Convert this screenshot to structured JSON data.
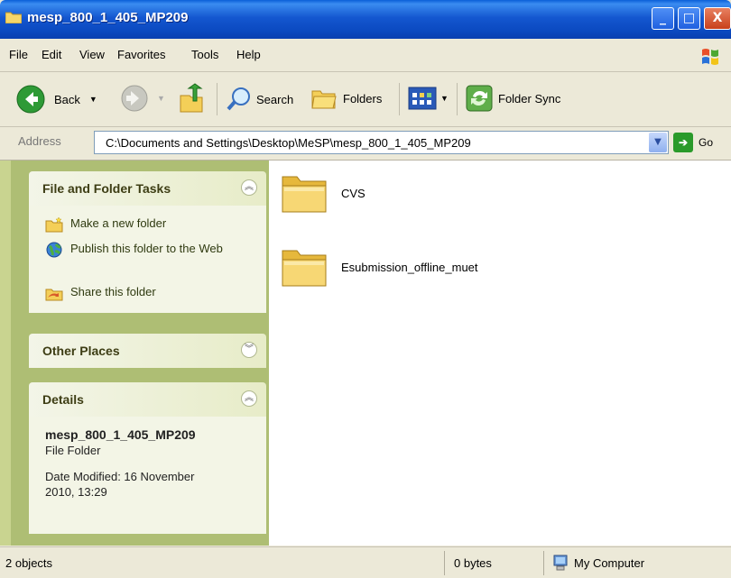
{
  "window": {
    "title": "mesp_800_1_405_MP209",
    "controls": {
      "minimize": "_",
      "maximize": "□",
      "close": "X"
    }
  },
  "menu": [
    "File",
    "Edit",
    "View",
    "Favorites",
    "Tools",
    "Help"
  ],
  "toolbar": {
    "back_label": "Back",
    "search_label": "Search",
    "folders_label": "Folders",
    "folder_sync_label": "Folder Sync"
  },
  "address": {
    "label": "Address",
    "path": "C:\\Documents and Settings\\Desktop\\MeSP\\mesp_800_1_405_MP209",
    "go_label": "Go"
  },
  "tasks": {
    "title": "File and Folder Tasks",
    "items": [
      {
        "label": "Make a new folder",
        "icon": "new-folder-icon"
      },
      {
        "label": "Publish this folder to the Web",
        "icon": "publish-web-icon"
      },
      {
        "label": "Share this folder",
        "icon": "share-folder-icon"
      }
    ]
  },
  "other_places": {
    "title": "Other Places"
  },
  "details": {
    "title": "Details",
    "name": "mesp_800_1_405_MP209",
    "type": "File Folder",
    "modified": "Date Modified: 16 November 2010, 13:29"
  },
  "files": [
    {
      "name": "CVS",
      "icon": "folder-icon"
    },
    {
      "name": "Esubmission_offline_muet",
      "icon": "folder-icon"
    }
  ],
  "status": {
    "objects": "2 objects",
    "size": "0 bytes",
    "location": "My Computer"
  },
  "colors": {
    "titlebar": "#0b49c0",
    "taskpane": "#aebe74",
    "panel_bg": "#f3f5e6"
  }
}
